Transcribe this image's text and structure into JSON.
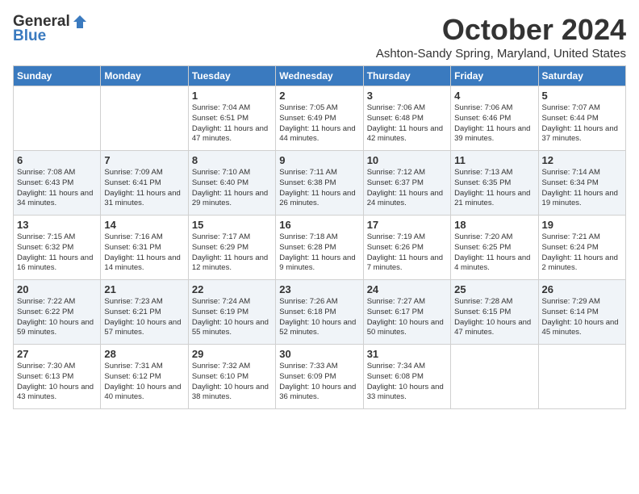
{
  "header": {
    "logo_general": "General",
    "logo_blue": "Blue",
    "month_title": "October 2024",
    "location": "Ashton-Sandy Spring, Maryland, United States"
  },
  "weekdays": [
    "Sunday",
    "Monday",
    "Tuesday",
    "Wednesday",
    "Thursday",
    "Friday",
    "Saturday"
  ],
  "weeks": [
    [
      {
        "day": "",
        "sunrise": "",
        "sunset": "",
        "daylight": ""
      },
      {
        "day": "",
        "sunrise": "",
        "sunset": "",
        "daylight": ""
      },
      {
        "day": "1",
        "sunrise": "Sunrise: 7:04 AM",
        "sunset": "Sunset: 6:51 PM",
        "daylight": "Daylight: 11 hours and 47 minutes."
      },
      {
        "day": "2",
        "sunrise": "Sunrise: 7:05 AM",
        "sunset": "Sunset: 6:49 PM",
        "daylight": "Daylight: 11 hours and 44 minutes."
      },
      {
        "day": "3",
        "sunrise": "Sunrise: 7:06 AM",
        "sunset": "Sunset: 6:48 PM",
        "daylight": "Daylight: 11 hours and 42 minutes."
      },
      {
        "day": "4",
        "sunrise": "Sunrise: 7:06 AM",
        "sunset": "Sunset: 6:46 PM",
        "daylight": "Daylight: 11 hours and 39 minutes."
      },
      {
        "day": "5",
        "sunrise": "Sunrise: 7:07 AM",
        "sunset": "Sunset: 6:44 PM",
        "daylight": "Daylight: 11 hours and 37 minutes."
      }
    ],
    [
      {
        "day": "6",
        "sunrise": "Sunrise: 7:08 AM",
        "sunset": "Sunset: 6:43 PM",
        "daylight": "Daylight: 11 hours and 34 minutes."
      },
      {
        "day": "7",
        "sunrise": "Sunrise: 7:09 AM",
        "sunset": "Sunset: 6:41 PM",
        "daylight": "Daylight: 11 hours and 31 minutes."
      },
      {
        "day": "8",
        "sunrise": "Sunrise: 7:10 AM",
        "sunset": "Sunset: 6:40 PM",
        "daylight": "Daylight: 11 hours and 29 minutes."
      },
      {
        "day": "9",
        "sunrise": "Sunrise: 7:11 AM",
        "sunset": "Sunset: 6:38 PM",
        "daylight": "Daylight: 11 hours and 26 minutes."
      },
      {
        "day": "10",
        "sunrise": "Sunrise: 7:12 AM",
        "sunset": "Sunset: 6:37 PM",
        "daylight": "Daylight: 11 hours and 24 minutes."
      },
      {
        "day": "11",
        "sunrise": "Sunrise: 7:13 AM",
        "sunset": "Sunset: 6:35 PM",
        "daylight": "Daylight: 11 hours and 21 minutes."
      },
      {
        "day": "12",
        "sunrise": "Sunrise: 7:14 AM",
        "sunset": "Sunset: 6:34 PM",
        "daylight": "Daylight: 11 hours and 19 minutes."
      }
    ],
    [
      {
        "day": "13",
        "sunrise": "Sunrise: 7:15 AM",
        "sunset": "Sunset: 6:32 PM",
        "daylight": "Daylight: 11 hours and 16 minutes."
      },
      {
        "day": "14",
        "sunrise": "Sunrise: 7:16 AM",
        "sunset": "Sunset: 6:31 PM",
        "daylight": "Daylight: 11 hours and 14 minutes."
      },
      {
        "day": "15",
        "sunrise": "Sunrise: 7:17 AM",
        "sunset": "Sunset: 6:29 PM",
        "daylight": "Daylight: 11 hours and 12 minutes."
      },
      {
        "day": "16",
        "sunrise": "Sunrise: 7:18 AM",
        "sunset": "Sunset: 6:28 PM",
        "daylight": "Daylight: 11 hours and 9 minutes."
      },
      {
        "day": "17",
        "sunrise": "Sunrise: 7:19 AM",
        "sunset": "Sunset: 6:26 PM",
        "daylight": "Daylight: 11 hours and 7 minutes."
      },
      {
        "day": "18",
        "sunrise": "Sunrise: 7:20 AM",
        "sunset": "Sunset: 6:25 PM",
        "daylight": "Daylight: 11 hours and 4 minutes."
      },
      {
        "day": "19",
        "sunrise": "Sunrise: 7:21 AM",
        "sunset": "Sunset: 6:24 PM",
        "daylight": "Daylight: 11 hours and 2 minutes."
      }
    ],
    [
      {
        "day": "20",
        "sunrise": "Sunrise: 7:22 AM",
        "sunset": "Sunset: 6:22 PM",
        "daylight": "Daylight: 10 hours and 59 minutes."
      },
      {
        "day": "21",
        "sunrise": "Sunrise: 7:23 AM",
        "sunset": "Sunset: 6:21 PM",
        "daylight": "Daylight: 10 hours and 57 minutes."
      },
      {
        "day": "22",
        "sunrise": "Sunrise: 7:24 AM",
        "sunset": "Sunset: 6:19 PM",
        "daylight": "Daylight: 10 hours and 55 minutes."
      },
      {
        "day": "23",
        "sunrise": "Sunrise: 7:26 AM",
        "sunset": "Sunset: 6:18 PM",
        "daylight": "Daylight: 10 hours and 52 minutes."
      },
      {
        "day": "24",
        "sunrise": "Sunrise: 7:27 AM",
        "sunset": "Sunset: 6:17 PM",
        "daylight": "Daylight: 10 hours and 50 minutes."
      },
      {
        "day": "25",
        "sunrise": "Sunrise: 7:28 AM",
        "sunset": "Sunset: 6:15 PM",
        "daylight": "Daylight: 10 hours and 47 minutes."
      },
      {
        "day": "26",
        "sunrise": "Sunrise: 7:29 AM",
        "sunset": "Sunset: 6:14 PM",
        "daylight": "Daylight: 10 hours and 45 minutes."
      }
    ],
    [
      {
        "day": "27",
        "sunrise": "Sunrise: 7:30 AM",
        "sunset": "Sunset: 6:13 PM",
        "daylight": "Daylight: 10 hours and 43 minutes."
      },
      {
        "day": "28",
        "sunrise": "Sunrise: 7:31 AM",
        "sunset": "Sunset: 6:12 PM",
        "daylight": "Daylight: 10 hours and 40 minutes."
      },
      {
        "day": "29",
        "sunrise": "Sunrise: 7:32 AM",
        "sunset": "Sunset: 6:10 PM",
        "daylight": "Daylight: 10 hours and 38 minutes."
      },
      {
        "day": "30",
        "sunrise": "Sunrise: 7:33 AM",
        "sunset": "Sunset: 6:09 PM",
        "daylight": "Daylight: 10 hours and 36 minutes."
      },
      {
        "day": "31",
        "sunrise": "Sunrise: 7:34 AM",
        "sunset": "Sunset: 6:08 PM",
        "daylight": "Daylight: 10 hours and 33 minutes."
      },
      {
        "day": "",
        "sunrise": "",
        "sunset": "",
        "daylight": ""
      },
      {
        "day": "",
        "sunrise": "",
        "sunset": "",
        "daylight": ""
      }
    ]
  ]
}
